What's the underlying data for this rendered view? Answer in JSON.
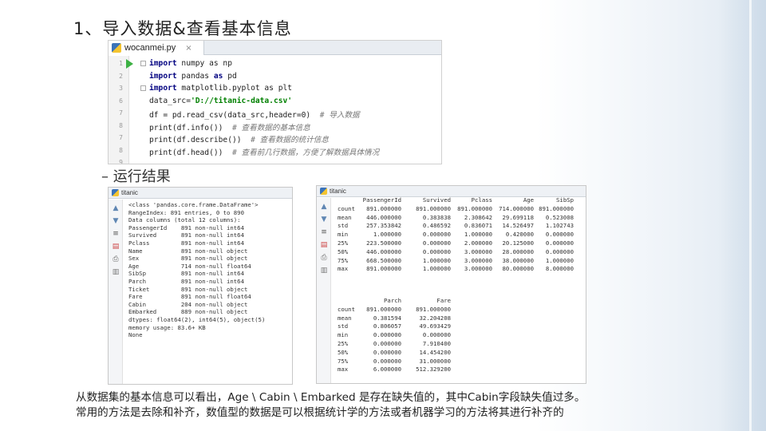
{
  "slide": {
    "title": "1、导入数据&查看基本信息",
    "bullet": "– 运行结果",
    "paragraph": [
      "从数据集的基本信息可以看出，Age \\ Cabin \\ Embarked 是存在缺失值的，其中Cabin字段缺失值过多。",
      "常用的方法是去除和补齐，数值型的数据是可以根据统计学的方法或者机器学习的方法将其进行补齐的"
    ]
  },
  "editor": {
    "tab_label": "wocanmei.py",
    "tab_close": "×",
    "icon": "python-file-icon",
    "lines": [
      {
        "n": "1",
        "code": [
          {
            "t": "kw",
            "v": "import"
          },
          {
            "t": "plain",
            "v": " numpy as np"
          }
        ]
      },
      {
        "n": "2",
        "code": [
          {
            "t": "kw",
            "v": "import"
          },
          {
            "t": "plain",
            "v": " pandas "
          },
          {
            "t": "kw",
            "v": "as"
          },
          {
            "t": "plain",
            "v": " pd"
          }
        ]
      },
      {
        "n": "3",
        "code": [
          {
            "t": "kw",
            "v": "import"
          },
          {
            "t": "plain",
            "v": " matplotlib.pyplot as plt"
          }
        ]
      },
      {
        "n": "6",
        "code": [
          {
            "t": "plain",
            "v": "data_src="
          },
          {
            "t": "str",
            "v": "'D://titanic-data.csv'"
          }
        ]
      },
      {
        "n": "7",
        "code": [
          {
            "t": "plain",
            "v": "df = pd.read_csv(data_src,header=0)  "
          },
          {
            "t": "cm",
            "v": "# 导入数据"
          }
        ]
      },
      {
        "n": "8",
        "code": [
          {
            "t": "plain",
            "v": "print(df.info())  "
          },
          {
            "t": "cm",
            "v": "# 查看数据的基本信息"
          }
        ]
      },
      {
        "n": "7",
        "code": [
          {
            "t": "plain",
            "v": "print(df.describe())  "
          },
          {
            "t": "cm",
            "v": "# 查看数据的统计信息"
          }
        ]
      },
      {
        "n": "8",
        "code": [
          {
            "t": "plain",
            "v": "print(df.head())  "
          },
          {
            "t": "cm",
            "v": "# 查看前几行数据，方便了解数据具体情况"
          }
        ]
      },
      {
        "n": "9",
        "code": [
          {
            "t": "plain",
            "v": ""
          }
        ]
      }
    ]
  },
  "panel_left": {
    "title": "titanic",
    "lines": [
      "<class 'pandas.core.frame.DataFrame'>",
      "RangeIndex: 891 entries, 0 to 890",
      "Data columns (total 12 columns):",
      "PassengerId    891 non-null int64",
      "Survived       891 non-null int64",
      "Pclass         891 non-null int64",
      "Name           891 non-null object",
      "Sex            891 non-null object",
      "Age            714 non-null float64",
      "SibSp          891 non-null int64",
      "Parch          891 non-null int64",
      "Ticket         891 non-null object",
      "Fare           891 non-null float64",
      "Cabin          204 non-null object",
      "Embarked       889 non-null object",
      "dtypes: float64(2), int64(5), object(5)",
      "memory usage: 83.6+ KB",
      "None"
    ]
  },
  "panel_right": {
    "title": "titanic",
    "header1": [
      "",
      "PassengerId",
      "Survived",
      "Pclass",
      "Age",
      "SibSp",
      "\\"
    ],
    "rows1": [
      [
        "count",
        "891.000000",
        "891.000000",
        "891.000000",
        "714.000000",
        "891.000000"
      ],
      [
        "mean",
        "446.000000",
        "0.383838",
        "2.308642",
        "29.699118",
        "0.523008"
      ],
      [
        "std",
        "257.353842",
        "0.486592",
        "0.836071",
        "14.526497",
        "1.102743"
      ],
      [
        "min",
        "1.000000",
        "0.000000",
        "1.000000",
        "0.420000",
        "0.000000"
      ],
      [
        "25%",
        "223.500000",
        "0.000000",
        "2.000000",
        "20.125000",
        "0.000000"
      ],
      [
        "50%",
        "446.000000",
        "0.000000",
        "3.000000",
        "28.000000",
        "0.000000"
      ],
      [
        "75%",
        "668.500000",
        "1.000000",
        "3.000000",
        "38.000000",
        "1.000000"
      ],
      [
        "max",
        "891.000000",
        "1.000000",
        "3.000000",
        "80.000000",
        "8.000000"
      ]
    ],
    "header2": [
      "",
      "Parch",
      "Fare"
    ],
    "rows2": [
      [
        "count",
        "891.000000",
        "891.000000"
      ],
      [
        "mean",
        "0.381594",
        "32.204208"
      ],
      [
        "std",
        "0.806057",
        "49.693429"
      ],
      [
        "min",
        "0.000000",
        "0.000000"
      ],
      [
        "25%",
        "0.000000",
        "7.910400"
      ],
      [
        "50%",
        "0.000000",
        "14.454200"
      ],
      [
        "75%",
        "0.000000",
        "31.000000"
      ],
      [
        "max",
        "6.000000",
        "512.329200"
      ]
    ]
  },
  "toolbar_icons": [
    "arrow-up-icon",
    "arrow-down-icon",
    "soft-wrap-icon",
    "scroll-to-end-icon",
    "print-icon",
    "trash-icon"
  ],
  "colors": {
    "keyword": "#000080",
    "string": "#008000",
    "comment": "#777777",
    "run_green": "#3cb043"
  }
}
